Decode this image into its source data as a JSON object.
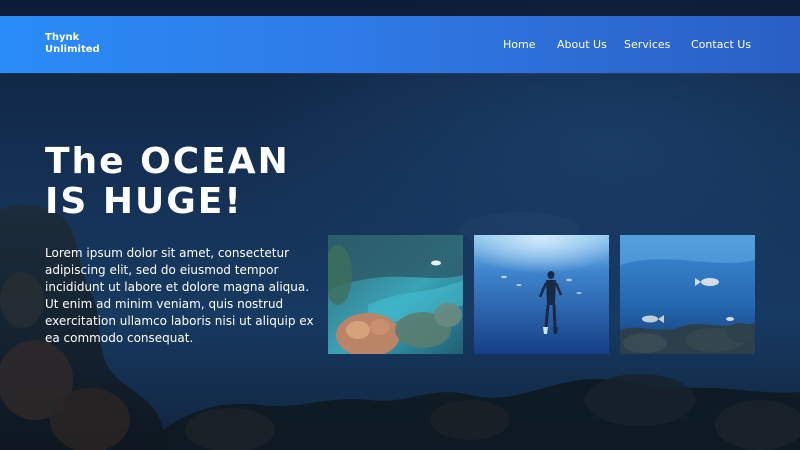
{
  "brand": {
    "line1": "Thynk",
    "line2": "Unlimited"
  },
  "nav": {
    "items": [
      {
        "label": "Home"
      },
      {
        "label": "About Us"
      },
      {
        "label": "Services"
      },
      {
        "label": "Contact Us"
      }
    ]
  },
  "hero": {
    "title_line1": "The OCEAN",
    "title_line2": "IS HUGE!",
    "body": "Lorem ipsum dolor sit amet, consectetur adipiscing elit, sed do eiusmod tempor incididunt ut labore et dolore magna aliqua. Ut enim ad minim veniam, quis nostrud exercitation ullamco laboris nisi ut aliquip ex ea commodo consequat."
  },
  "gallery": {
    "images": [
      {
        "subject": "coral-reef-photo"
      },
      {
        "subject": "diver-photo"
      },
      {
        "subject": "reef-fish-photo"
      }
    ]
  },
  "colors": {
    "nav_gradient_start": "#2a8cf7",
    "nav_gradient_end": "#2a5fc4",
    "background": "#153257",
    "text": "#ffffff"
  }
}
